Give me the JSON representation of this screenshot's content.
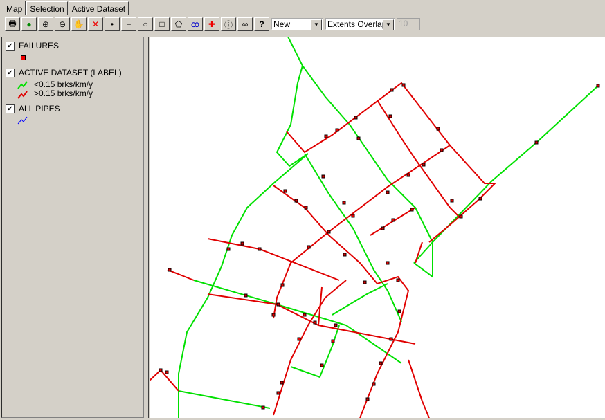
{
  "tabs": [
    {
      "label": "Map",
      "active": true
    },
    {
      "label": "Selection"
    },
    {
      "label": "Active Dataset"
    }
  ],
  "toolbar": {
    "buttons": [
      "print-icon",
      "globe-icon",
      "zoom-in-icon",
      "zoom-out-icon",
      "pan-hand-icon",
      "clear-selection-icon",
      "point-icon",
      "line-icon",
      "circle-icon",
      "rectangle-icon",
      "polygon-icon",
      "lasso-icon",
      "add-layer-icon",
      "info-icon",
      "binoculars-icon",
      "help-icon"
    ],
    "selection_mode": "New",
    "overlap_mode": "Extents Overlap",
    "tolerance": "10"
  },
  "legend": {
    "layers": [
      {
        "label": "FAILURES",
        "checked": true
      },
      {
        "label": "ACTIVE DATASET (LABEL)",
        "checked": true,
        "classes": [
          "<0.15 brks/km/y",
          ">0.15 brks/km/y"
        ]
      },
      {
        "label": "ALL PIPES",
        "checked": true
      }
    ]
  },
  "colors": {
    "low": "#00e000",
    "high": "#e00000",
    "all_pipes": "#0000ff",
    "failure": "#e00000"
  }
}
